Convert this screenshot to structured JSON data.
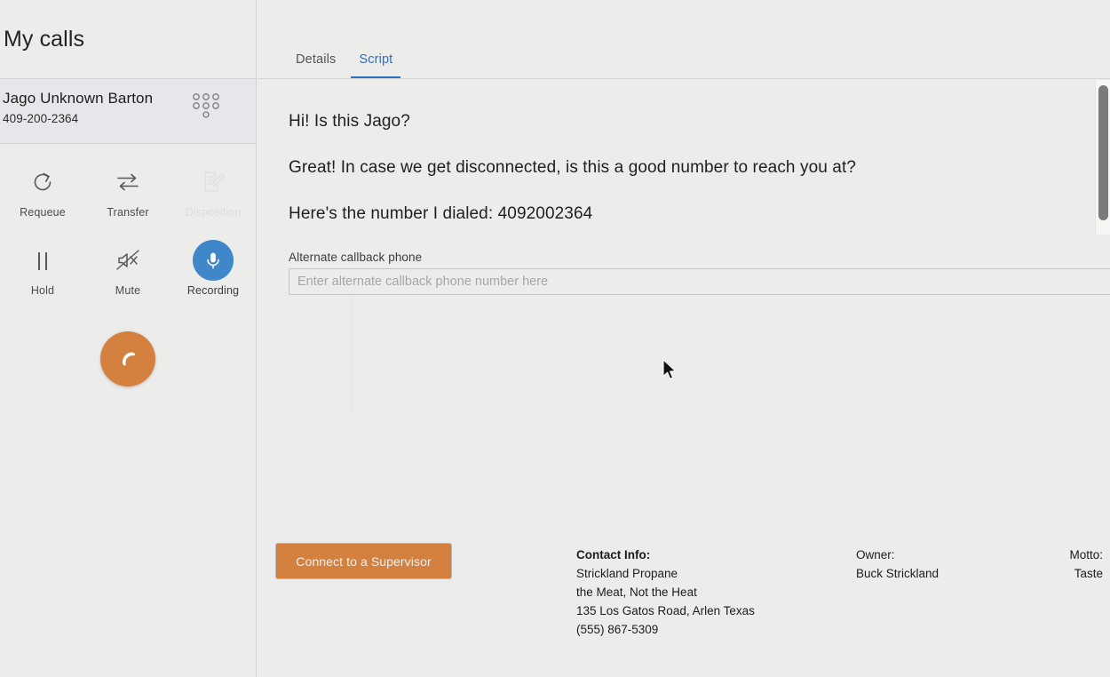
{
  "sidebar": {
    "title": "My calls",
    "call": {
      "name": "Jago Unknown Barton",
      "number": "409-200-2364",
      "menu_icon": "dialpad-icon"
    },
    "controls": [
      {
        "label": "Requeue",
        "icon": "requeue-icon",
        "state": "enabled"
      },
      {
        "label": "Transfer",
        "icon": "transfer-icon",
        "state": "enabled"
      },
      {
        "label": "Disposition",
        "icon": "disposition-icon",
        "state": "disabled"
      },
      {
        "label": "Hold",
        "icon": "pause-icon",
        "state": "enabled"
      },
      {
        "label": "Mute",
        "icon": "mute-icon",
        "state": "enabled"
      },
      {
        "label": "Recording",
        "icon": "microphone-icon",
        "state": "active"
      }
    ],
    "hangup": {
      "icon": "phone-handset-icon",
      "color": "#d4813f"
    }
  },
  "main": {
    "tabs": [
      {
        "label": "Details",
        "active": false
      },
      {
        "label": "Script",
        "active": true
      }
    ],
    "script": {
      "lines": [
        "Hi! Is this Jago?",
        "Great! In case we get disconnected, is this a good number to reach you at?",
        "Here's the number I dialed: 4092002364"
      ]
    },
    "callback_field": {
      "label": "Alternate callback phone",
      "placeholder": "Enter alternate callback phone number here",
      "value": ""
    },
    "footer": {
      "supervisor_button": "Connect to a Supervisor",
      "contact": {
        "header": "Contact Info:",
        "line1": "Strickland Propane",
        "line2": "the Meat, Not the Heat",
        "line3": "135 Los Gatos Road, Arlen Texas",
        "line4": "(555) 867-5309"
      },
      "owner": {
        "header": "Owner:",
        "value": "Buck Strickland"
      },
      "motto": {
        "header": "Motto:",
        "value": "Taste"
      }
    }
  },
  "colors": {
    "accent_blue": "#2f6fc4",
    "recording_blue": "#3f87c9",
    "orange": "#d4813f",
    "background": "#ececeb"
  }
}
